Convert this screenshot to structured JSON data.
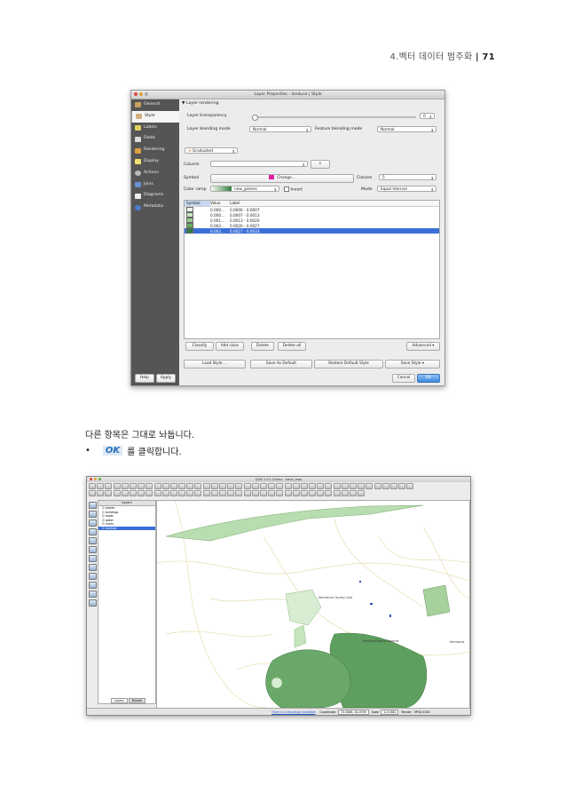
{
  "header": {
    "chapter": "4.벡터 데이터 범주화",
    "separator": "|",
    "page": "71"
  },
  "dialog": {
    "title": "Layer Properties - landuse | Style",
    "sidebar": [
      "General",
      "Style",
      "Labels",
      "Fields",
      "Rendering",
      "Display",
      "Actions",
      "Joins",
      "Diagrams",
      "Metadata"
    ],
    "section": "Layer rendering",
    "transparency_label": "Layer transparency",
    "transparency_value": "0",
    "blending_label": "Layer blending mode",
    "blending_value": "Normal",
    "feature_blending_label": "Feature blending mode",
    "feature_blending_value": "Normal",
    "renderer": "Graduated",
    "column_label": "Column",
    "column_expr_btn": "ε",
    "symbol_label": "Symbol",
    "symbol_change": "Change...",
    "classes_label": "Classes",
    "classes_value": "5",
    "ramp_label": "Color ramp",
    "ramp_value": "new_greens",
    "invert_label": "Invert",
    "mode_label": "Mode",
    "mode_value": "Equal Interval",
    "table_headers": [
      "Symbol",
      "Value",
      "Label"
    ],
    "rows": [
      {
        "value": "0.000...",
        "label": "0.0000 - 0.0007",
        "color": "#f0f8ec"
      },
      {
        "value": "0.000...",
        "label": "0.0007 - 0.0013",
        "color": "#c8e6c0"
      },
      {
        "value": "0.001...",
        "label": "0.0013 - 0.0020",
        "color": "#98cf8e"
      },
      {
        "value": "0.002...",
        "label": "0.0020 - 0.0027",
        "color": "#62ad62"
      },
      {
        "value": "0.002...",
        "label": "0.0027 - 0.0033",
        "color": "#2e7d3a"
      }
    ],
    "buttons": {
      "classify": "Classify",
      "add_class": "Add class",
      "delete": "Delete",
      "delete_all": "Delete all",
      "advanced": "Advanced",
      "load_style": "Load Style ...",
      "save_default": "Save As Default",
      "restore_default": "Restore Default Style",
      "save_style": "Save Style",
      "help": "Help",
      "apply": "Apply",
      "cancel": "Cancel",
      "ok": "OK"
    }
  },
  "body": {
    "line1": "다른 항목은 그대로 놔둡니다.",
    "bullet": "•",
    "ok_label": "OK",
    "line2": "를 클릭합니다."
  },
  "qgis": {
    "title": "QGIS 2.0.1-Dufour - basic_map",
    "layers_header": "Layers",
    "layers": [
      "places",
      "buildings",
      "roads",
      "water",
      "rivers",
      "landuse"
    ],
    "selected_layer": "landuse",
    "tabs": [
      "Layers",
      "Browse"
    ],
    "status": {
      "plugin_msg": "There is a new plugin available",
      "coord_label": "Coordinate:",
      "coord_value": "33.4086,-34.0599",
      "scale_label": "Scale",
      "scale_value": "1:23,882",
      "render_label": "Render",
      "crs": "EPSG:4326"
    },
    "map_labels": [
      "Hermanus Country Club",
      "Fernkloof Nature Reserve",
      "Hermanus"
    ]
  }
}
